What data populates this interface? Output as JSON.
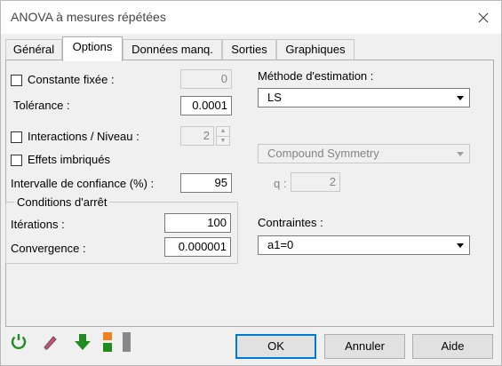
{
  "window": {
    "title": "ANOVA à mesures répétées"
  },
  "tabs": [
    {
      "label": "Général"
    },
    {
      "label": "Options"
    },
    {
      "label": "Données manq."
    },
    {
      "label": "Sorties"
    },
    {
      "label": "Graphiques"
    }
  ],
  "options": {
    "constante_label": "Constante fixée :",
    "constante_value": "0",
    "tolerance_label": "Tolérance :",
    "tolerance_value": "0.0001",
    "interactions_label": "Interactions / Niveau :",
    "interactions_value": "2",
    "effets_label": "Effets imbriqués",
    "intervalle_label": "Intervalle de confiance (%) :",
    "intervalle_value": "95",
    "conditions": {
      "legend": "Conditions d'arrêt",
      "iterations_label": "Itérations :",
      "iterations_value": "100",
      "convergence_label": "Convergence :",
      "convergence_value": "0.000001"
    },
    "methode_label": "Méthode d'estimation :",
    "methode_value": "LS",
    "covariance_value": "Compound Symmetry",
    "q_label": "q :",
    "q_value": "2",
    "contraintes_label": "Contraintes :",
    "contraintes_value": "a1=0"
  },
  "buttons": {
    "ok": "OK",
    "annuler": "Annuler",
    "aide": "Aide"
  },
  "icons": {
    "reset": "refresh-icon",
    "eraser": "eraser-icon",
    "download": "arrow-down-icon",
    "layout": "layout-toggle-icon"
  },
  "colors": {
    "accent": "#0078d7",
    "green": "#1e8c1e",
    "orange": "#f08020"
  }
}
